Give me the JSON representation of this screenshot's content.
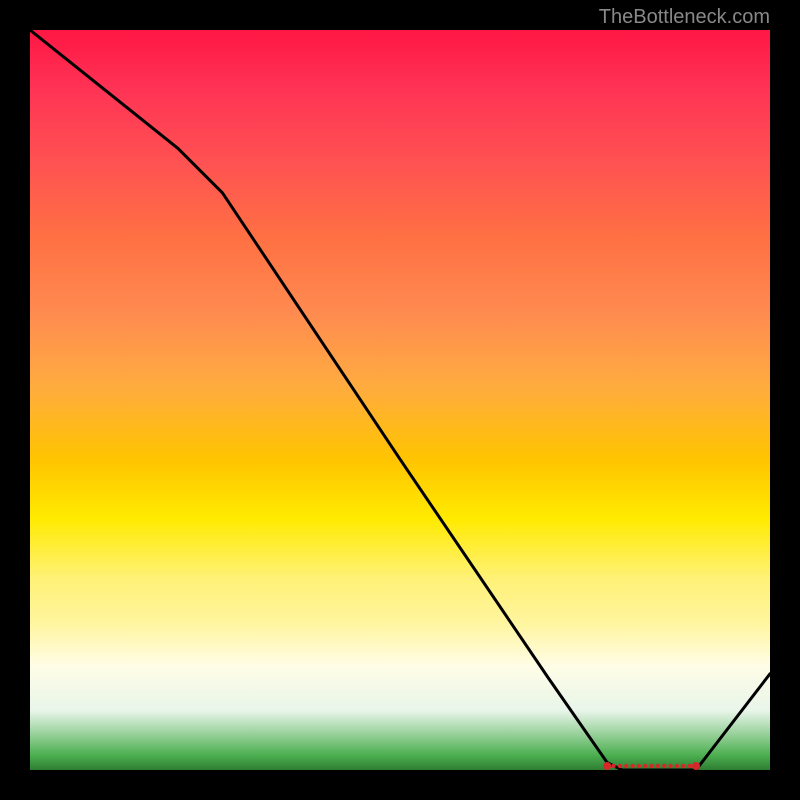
{
  "attribution": "TheBottleneck.com",
  "chart_data": {
    "type": "line",
    "title": "",
    "xlabel": "",
    "ylabel": "",
    "xlim": [
      0,
      100
    ],
    "ylim": [
      0,
      100
    ],
    "x": [
      0,
      10,
      20,
      26,
      50,
      70,
      78,
      80,
      84,
      86,
      88,
      90,
      100
    ],
    "values": [
      100,
      92,
      84,
      78,
      42,
      12.5,
      1,
      0,
      0,
      0,
      0,
      0,
      13
    ],
    "annotations": [
      {
        "type": "dot-cluster",
        "x_start": 78,
        "x_end": 90,
        "y": 0
      }
    ]
  }
}
